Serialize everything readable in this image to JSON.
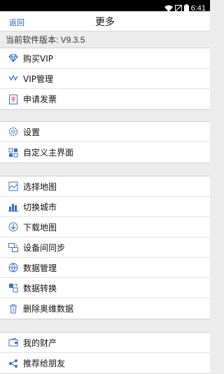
{
  "status_bar": {
    "time": "6:41"
  },
  "nav": {
    "back_label": "返回",
    "title": "更多"
  },
  "version_label": "当前软件版本: V9.3.5",
  "groups": [
    {
      "items": [
        {
          "label": "购买VIP",
          "icon": "diamond-icon"
        },
        {
          "label": "VIP管理",
          "icon": "vip-manage-icon"
        },
        {
          "label": "申请发票",
          "icon": "invoice-icon"
        }
      ]
    },
    {
      "items": [
        {
          "label": "设置",
          "icon": "gear-icon"
        },
        {
          "label": "自定义主界面",
          "icon": "customize-icon"
        }
      ]
    },
    {
      "items": [
        {
          "label": "选择地图",
          "icon": "map-select-icon"
        },
        {
          "label": "切换城市",
          "icon": "city-icon"
        },
        {
          "label": "下载地图",
          "icon": "download-map-icon"
        },
        {
          "label": "设备间同步",
          "icon": "sync-icon"
        },
        {
          "label": "数据管理",
          "icon": "data-manage-icon"
        },
        {
          "label": "数据转换",
          "icon": "data-convert-icon"
        },
        {
          "label": "删除奥维数据",
          "icon": "delete-data-icon"
        }
      ]
    },
    {
      "items": [
        {
          "label": "我的财产",
          "icon": "wallet-icon"
        },
        {
          "label": "推荐给朋友",
          "icon": "share-icon"
        }
      ]
    }
  ]
}
